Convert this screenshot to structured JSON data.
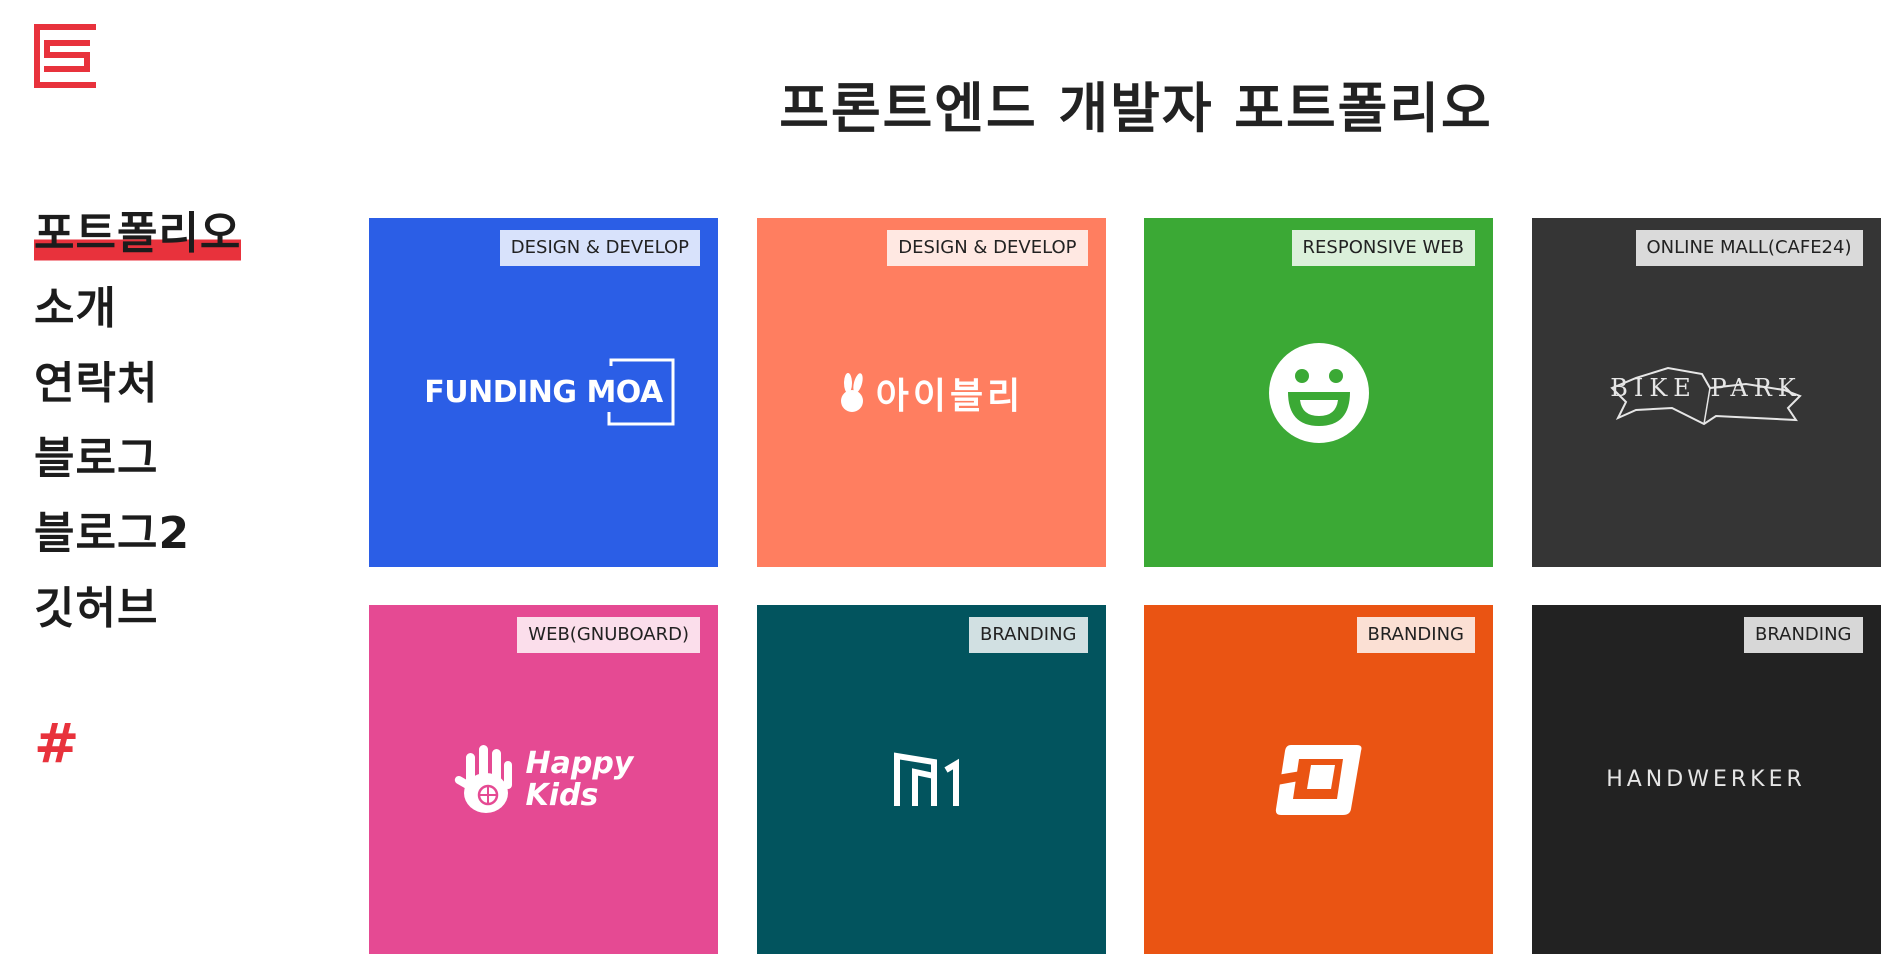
{
  "page": {
    "title": "프론트엔드 개발자 포트폴리오"
  },
  "nav": {
    "items": [
      {
        "label": "포트폴리오",
        "active": true
      },
      {
        "label": "소개"
      },
      {
        "label": "연락처"
      },
      {
        "label": "블로그"
      },
      {
        "label": "블로그2"
      },
      {
        "label": "깃허브"
      }
    ],
    "hash": "#"
  },
  "colors": {
    "accent": "#e8323c"
  },
  "cards": [
    {
      "tag": "DESIGN & DEVELOP",
      "brand": "FUNDING MOA",
      "bg": "#2b5ee6"
    },
    {
      "tag": "DESIGN & DEVELOP",
      "brand": "아이블리",
      "bg": "#ff7e60"
    },
    {
      "tag": "RESPONSIVE WEB",
      "brand": "smiley-icon",
      "bg": "#3ba935"
    },
    {
      "tag": "ONLINE MALL(CAFE24)",
      "brand": "BIKE PARK",
      "bg": "#353535"
    },
    {
      "tag": "WEB(GNUBOARD)",
      "brand": "Happy Kids",
      "bg": "#e54a93"
    },
    {
      "tag": "BRANDING",
      "brand": "m1-icon",
      "bg": "#02545e"
    },
    {
      "tag": "BRANDING",
      "brand": "square-icon",
      "bg": "#ea5413"
    },
    {
      "tag": "BRANDING",
      "brand": "HANDWERKER",
      "bg": "#222222"
    }
  ]
}
